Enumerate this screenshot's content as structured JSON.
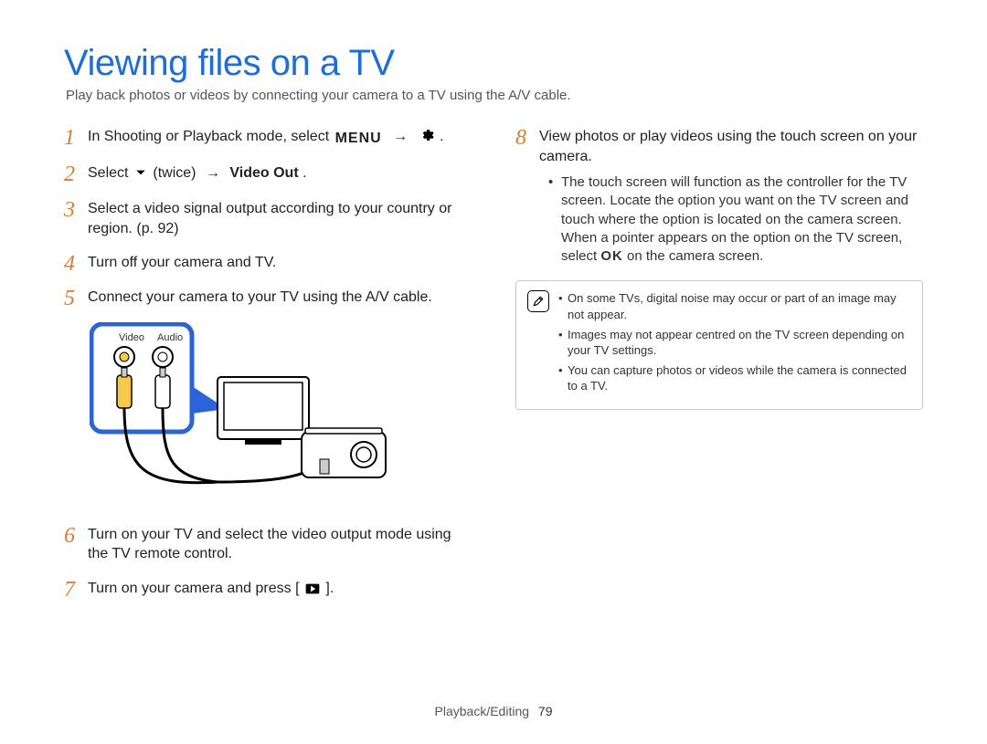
{
  "title": "Viewing files on a TV",
  "subtitle": "Play back photos or videos by connecting your camera to a TV using the A/V cable.",
  "steps": {
    "s1_pre": "In Shooting or Playback mode, select ",
    "s1_post": ".",
    "s2_pre": "Select ",
    "s2_mid": " (twice) ",
    "s2_link": "Video Out",
    "s2_post": ".",
    "s3": "Select a video signal output according to your country or region. (p. 92)",
    "s4": "Turn off your camera and TV.",
    "s5": "Connect your camera to your TV using the A/V cable.",
    "s6": "Turn on your TV and select the video output mode using the TV remote control.",
    "s7_pre": "Turn on your camera and press [",
    "s7_post": "].",
    "s8": "View photos or play videos using the touch screen on your camera.",
    "s8_sub_pre": "The touch screen will function as the controller for the TV screen. Locate the option you want on the TV screen and touch where the option is located on the camera screen. When a pointer appears on the option on the TV screen, select ",
    "s8_sub_post": " on the camera screen."
  },
  "diagram": {
    "video_label": "Video",
    "audio_label": "Audio"
  },
  "notes": {
    "n1": "On some TVs, digital noise may occur or part of an image may not appear.",
    "n2": "Images may not appear centred on the TV screen depending on your TV settings.",
    "n3": "You can capture photos or videos while the camera is connected to a TV."
  },
  "footer": {
    "section": "Playback/Editing",
    "page": "79"
  },
  "glyphs": {
    "menu": "MENU",
    "arrow": "→",
    "ok": "OK"
  }
}
